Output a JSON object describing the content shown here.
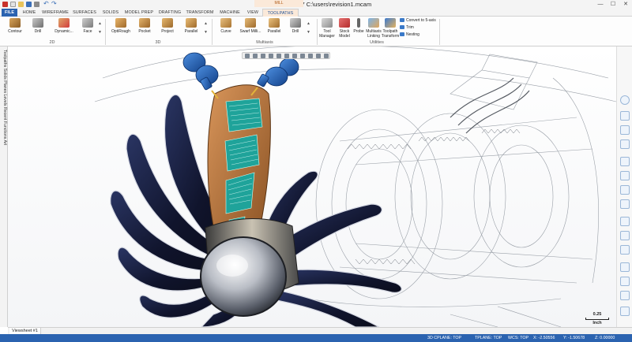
{
  "window": {
    "title": "Mastercam 2017  C:\\users\\revision1.mcam",
    "context_tab_group": "MILL",
    "controls": {
      "minimize": "—",
      "maximize": "☐",
      "close": "✕"
    }
  },
  "tabs": [
    {
      "label": "FILE"
    },
    {
      "label": "HOME"
    },
    {
      "label": "WIREFRAME"
    },
    {
      "label": "SURFACES"
    },
    {
      "label": "SOLIDS"
    },
    {
      "label": "MODEL PREP"
    },
    {
      "label": "DRAFTING"
    },
    {
      "label": "TRANSFORM"
    },
    {
      "label": "MACHINE"
    },
    {
      "label": "VIEW"
    },
    {
      "label": "TOOLPATHS"
    }
  ],
  "ribbon": {
    "groups": {
      "g2d": "2D",
      "g3d": "3D",
      "multiaxis": "Multiaxis",
      "utilities": "Utilities"
    },
    "buttons_2d": [
      "Contour",
      "Drill",
      "Dynamic...",
      "Face"
    ],
    "buttons_3d": [
      "OptiRough",
      "Pocket",
      "Project",
      "Parallel"
    ],
    "buttons_multiaxis": [
      "Curve",
      "Swarf Milli...",
      "Parallel",
      "Drill"
    ],
    "utility_buttons": [
      "Tool Manager",
      "Stock Model",
      "Probe",
      "Multiaxis Linking",
      "Toolpath Transform"
    ],
    "small_buttons": [
      "Convert to 5-axis",
      "Trim",
      "Nesting"
    ]
  },
  "left_panel": {
    "vertical_tabs": "Toolpaths  Solids  Planes  Levels  Recent Functions  Art"
  },
  "viewsheet": {
    "tab": "Viewsheet #1"
  },
  "scale": {
    "value": "0.25",
    "unit": "Inch"
  },
  "status": {
    "cplane": "3D  CPLANE: TOP",
    "tplane": "TPLANE: TOP",
    "wcs": "WCS: TOP",
    "x": "X:  -2.50556",
    "y": "Y:  -1.50678",
    "z": "Z:  0.00000"
  },
  "colors": {
    "accent": "#2b63b0",
    "context_tab": "#fbe9d9",
    "blade": "#151a3a",
    "toolpath": "#1fa39a",
    "part": "#b5733a",
    "spindle": "#1f61b6"
  }
}
